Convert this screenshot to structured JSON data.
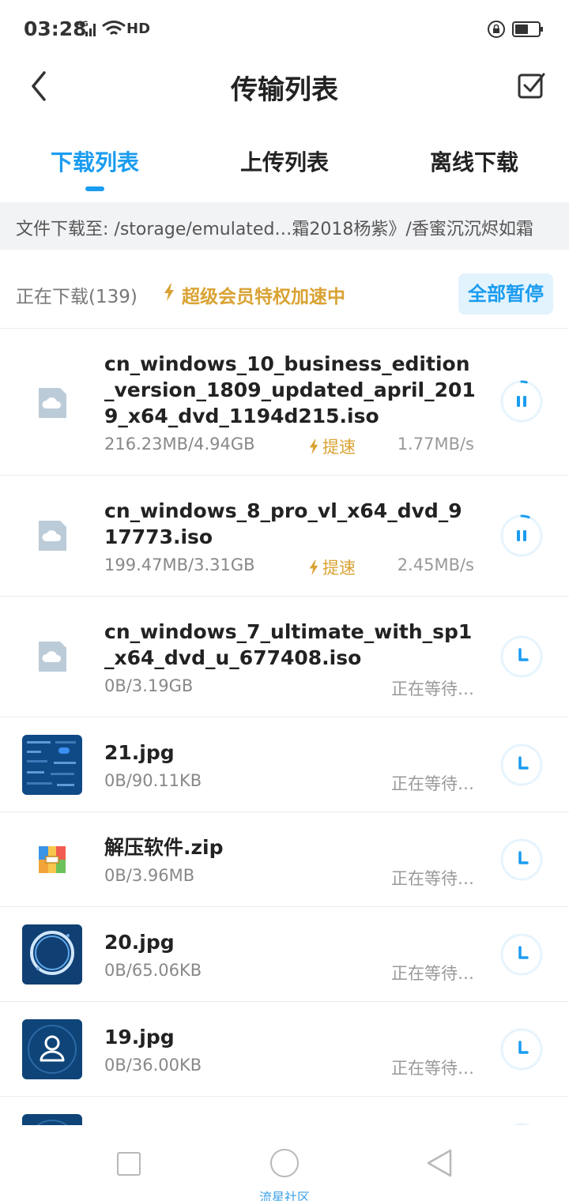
{
  "status_bar": {
    "time": "03:28",
    "network": "4G",
    "hd": "HD"
  },
  "header": {
    "title": "传输列表"
  },
  "tabs": [
    {
      "label": "下载列表",
      "active": true
    },
    {
      "label": "上传列表",
      "active": false
    },
    {
      "label": "离线下载",
      "active": false
    }
  ],
  "path": "文件下载至: /storage/emulated…霜2018杨紫》/香蜜沉沉烬如霜",
  "section": {
    "downloading": "正在下载(139)",
    "vip": "超级会员特权加速中",
    "pause_all": "全部暂停"
  },
  "boost_label": "提速",
  "files": [
    {
      "name": "cn_windows_10_business_edition_version_1809_updated_april_2019_x64_dvd_1194d215.iso",
      "size": "216.23MB/4.94GB",
      "speed": "1.77MB/s",
      "state": "downloading",
      "progress": 0.04,
      "icon": "file-icon"
    },
    {
      "name": "cn_windows_8_pro_vl_x64_dvd_917773.iso",
      "size": "199.47MB/3.31GB",
      "speed": "2.45MB/s",
      "state": "downloading",
      "progress": 0.06,
      "icon": "file-icon"
    },
    {
      "name": "cn_windows_7_ultimate_with_sp1_x64_dvd_u_677408.iso",
      "size": "0B/3.19GB",
      "status": "正在等待…",
      "state": "waiting",
      "icon": "file-icon"
    },
    {
      "name": "21.jpg",
      "size": "0B/90.11KB",
      "status": "正在等待…",
      "state": "waiting",
      "icon": "image-thumbnail"
    },
    {
      "name": "解压软件.zip",
      "size": "0B/3.96MB",
      "status": "正在等待…",
      "state": "waiting",
      "icon": "zip-icon"
    },
    {
      "name": "20.jpg",
      "size": "0B/65.06KB",
      "status": "正在等待…",
      "state": "waiting",
      "icon": "image-thumbnail"
    },
    {
      "name": "19.jpg",
      "size": "0B/36.00KB",
      "status": "正在等待…",
      "state": "waiting",
      "icon": "image-thumbnail"
    }
  ],
  "nav": {
    "watermark": "流星社区"
  },
  "colors": {
    "accent": "#1a9cf0",
    "vip_gold": "#d9a233",
    "path_bg": "#f2f3f5"
  }
}
